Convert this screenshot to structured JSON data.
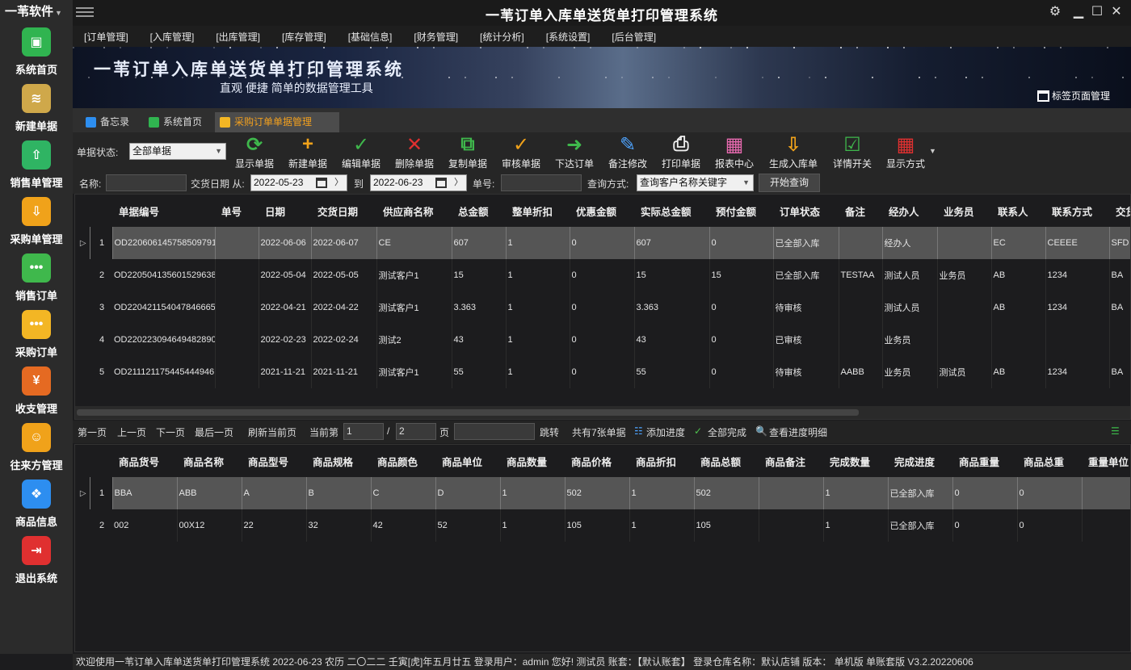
{
  "app": {
    "brand": "一苇软件",
    "title": "一苇订单入库单送货单打印管理系统"
  },
  "sidebar": {
    "items": [
      {
        "label": "系统首页",
        "icon": "cube-icon",
        "color": "#30b450"
      },
      {
        "label": "新建单据",
        "icon": "layers-add-icon",
        "color": "#cfa84a"
      },
      {
        "label": "销售单管理",
        "icon": "box-out-icon",
        "color": "#2fb463"
      },
      {
        "label": "采购单管理",
        "icon": "box-in-icon",
        "color": "#f0a21a"
      },
      {
        "label": "销售订单",
        "icon": "chat-dots-icon",
        "color": "#3fb84c"
      },
      {
        "label": "采购订单",
        "icon": "chat-dots-icon",
        "color": "#f3b624"
      },
      {
        "label": "收支管理",
        "icon": "yen-icon",
        "color": "#e56a22"
      },
      {
        "label": "往来方管理",
        "icon": "users-icon",
        "color": "#f0a21a"
      },
      {
        "label": "商品信息",
        "icon": "cubes-icon",
        "color": "#2d8ef0"
      },
      {
        "label": "退出系统",
        "icon": "exit-icon",
        "color": "#e03030"
      }
    ]
  },
  "menu": [
    "[订单管理]",
    "[入库管理]",
    "[出库管理]",
    "[库存管理]",
    "[基础信息]",
    "[财务管理]",
    "[统计分析]",
    "[系统设置]",
    "[后台管理]"
  ],
  "banner": {
    "title": "一苇订单入库单送货单打印管理系统",
    "subtitle": "直观 便捷 简单的数据管理工具",
    "tag_manager": "标签页面管理"
  },
  "tabs": [
    "备忘录",
    "系统首页",
    "采购订单单据管理"
  ],
  "toolbar": {
    "state_label": "单据状态:",
    "state_value": "全部单据",
    "buttons": [
      "显示单据",
      "新建单据",
      "编辑单据",
      "删除单据",
      "复制单据",
      "审核单据",
      "下达订单",
      "备注修改",
      "打印单据",
      "报表中心",
      "生成入库单",
      "详情开关",
      "显示方式"
    ]
  },
  "search": {
    "name_label": "名称:",
    "date_label": "交货日期 从:",
    "date_from": "2022-05-23",
    "to_label": "到",
    "date_to": "2022-06-23",
    "no_label": "单号:",
    "mode_label": "查询方式:",
    "mode_value": "查询客户名称关键字",
    "query_button": "开始查询"
  },
  "orders": {
    "columns": [
      "单据编号",
      "单号",
      "日期",
      "交货日期",
      "供应商名称",
      "总金额",
      "整单折扣",
      "优惠金额",
      "实际总金额",
      "预付金额",
      "订单状态",
      "备注",
      "经办人",
      "业务员",
      "联系人",
      "联系方式",
      "交货"
    ],
    "rows": [
      {
        "n": "1",
        "c": [
          "OD220606145758509791",
          "",
          "2022-06-06",
          "2022-06-07",
          "CE",
          "607",
          "1",
          "0",
          "607",
          "0",
          "已全部入库",
          "",
          "经办人",
          "",
          "EC",
          "CEEEE",
          "SFD"
        ]
      },
      {
        "n": "2",
        "c": [
          "OD220504135601529638",
          "",
          "2022-05-04",
          "2022-05-05",
          "测试客户1",
          "15",
          "1",
          "0",
          "15",
          "15",
          "已全部入库",
          "TESTAA",
          "测试人员",
          "业务员",
          "AB",
          "1234",
          "BA"
        ]
      },
      {
        "n": "3",
        "c": [
          "OD220421154047846665",
          "",
          "2022-04-21",
          "2022-04-22",
          "测试客户1",
          "3.363",
          "1",
          "0",
          "3.363",
          "0",
          "待审核",
          "",
          "测试人员",
          "",
          "AB",
          "1234",
          "BA"
        ]
      },
      {
        "n": "4",
        "c": [
          "OD220223094649482890",
          "",
          "2022-02-23",
          "2022-02-24",
          "测试2",
          "43",
          "1",
          "0",
          "43",
          "0",
          "已审核",
          "",
          "业务员",
          "",
          "",
          "",
          ""
        ]
      },
      {
        "n": "5",
        "c": [
          "OD211121175445444946",
          "",
          "2021-11-21",
          "2021-11-21",
          "测试客户1",
          "55",
          "1",
          "0",
          "55",
          "0",
          "待审核",
          "AABB",
          "业务员",
          "测试员",
          "AB",
          "1234",
          "BA"
        ]
      }
    ]
  },
  "pager": {
    "first": "第一页",
    "prev": "上一页",
    "next": "下一页",
    "last": "最后一页",
    "refresh": "刷新当前页",
    "current_label": "当前第",
    "current": "1",
    "slash": "/",
    "total_pages": "2",
    "page_label": "页",
    "jump": "跳转",
    "total_text": "共有7张单据",
    "add_progress": "添加进度",
    "all_done": "全部完成",
    "view_progress": "查看进度明细"
  },
  "items": {
    "columns": [
      "商品货号",
      "商品名称",
      "商品型号",
      "商品规格",
      "商品颜色",
      "商品单位",
      "商品数量",
      "商品价格",
      "商品折扣",
      "商品总额",
      "商品备注",
      "完成数量",
      "完成进度",
      "商品重量",
      "商品总重",
      "重量单位"
    ],
    "rows": [
      {
        "n": "1",
        "c": [
          "BBA",
          "ABB",
          "A",
          "B",
          "C",
          "D",
          "1",
          "502",
          "1",
          "502",
          "",
          "1",
          "已全部入库",
          "0",
          "0",
          ""
        ]
      },
      {
        "n": "2",
        "c": [
          "002",
          "00X12",
          "22",
          "32",
          "42",
          "52",
          "1",
          "105",
          "1",
          "105",
          "",
          "1",
          "已全部入库",
          "0",
          "0",
          ""
        ]
      }
    ]
  },
  "status": "欢迎使用一苇订单入库单送货单打印管理系统 2022-06-23 农历 二〇二二 壬寅[虎]年五月廿五 登录用户：admin 您好! 测试员 账套：【默认账套】 登录仓库名称：默认店铺 版本： 单机版 单账套版 V3.2.20220606"
}
